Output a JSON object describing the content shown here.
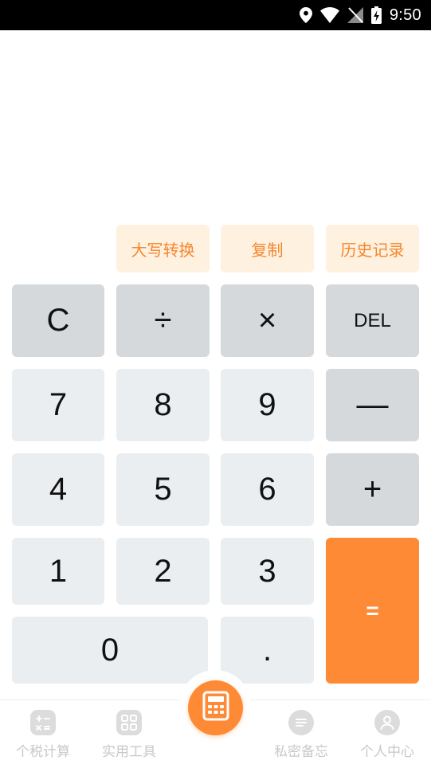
{
  "status_bar": {
    "time": "9:50",
    "icons": [
      "location-icon",
      "wifi-icon",
      "no-signal-icon",
      "battery-charging-icon"
    ]
  },
  "display": {
    "expression": "",
    "result": ""
  },
  "utility_buttons": {
    "uppercase": "大写转换",
    "copy": "复制",
    "history": "历史记录"
  },
  "keypad": {
    "clear": "C",
    "divide": "÷",
    "multiply": "×",
    "delete": "DEL",
    "seven": "7",
    "eight": "8",
    "nine": "9",
    "minus": "—",
    "four": "4",
    "five": "5",
    "six": "6",
    "plus": "+",
    "one": "1",
    "two": "2",
    "three": "3",
    "equals": "=",
    "zero": "0",
    "decimal": "."
  },
  "tabbar": {
    "tabs": [
      {
        "label": "个税计算",
        "icon": "tax-calculator-icon"
      },
      {
        "label": "实用工具",
        "icon": "grid-tools-icon"
      },
      {
        "label": "私密备忘",
        "icon": "memo-icon"
      },
      {
        "label": "个人中心",
        "icon": "user-icon"
      }
    ],
    "center_icon": "calculator-icon"
  },
  "colors": {
    "accent": "#ff8a36",
    "util_bg": "#fff1e0",
    "util_text": "#f4872f",
    "num_key": "#eaeef0",
    "op_key": "#d5d9dc"
  }
}
